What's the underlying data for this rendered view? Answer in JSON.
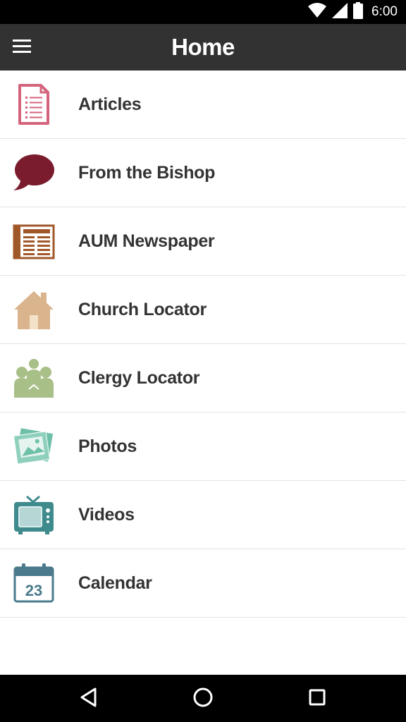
{
  "status_bar": {
    "time": "6:00",
    "icons": [
      "wifi-icon",
      "signal-icon",
      "battery-icon"
    ]
  },
  "app_bar": {
    "title": "Home",
    "menu_icon": "hamburger-menu-icon"
  },
  "menu": {
    "items": [
      {
        "label": "Articles",
        "icon": "document-icon",
        "color": "#d4647c"
      },
      {
        "label": "From the Bishop",
        "icon": "speech-bubble-icon",
        "color": "#7a1c2e"
      },
      {
        "label": "AUM Newspaper",
        "icon": "newspaper-icon",
        "color": "#a0582a"
      },
      {
        "label": "Church Locator",
        "icon": "house-icon",
        "color": "#d9b48c"
      },
      {
        "label": "Clergy Locator",
        "icon": "people-icon",
        "color": "#a9bf88"
      },
      {
        "label": "Photos",
        "icon": "photos-icon",
        "color": "#6dbfa8"
      },
      {
        "label": "Videos",
        "icon": "tv-icon",
        "color": "#3f8a8c"
      },
      {
        "label": "Calendar",
        "icon": "calendar-icon",
        "color": "#4a7a8c",
        "day": "23"
      }
    ]
  },
  "nav_bar": {
    "icons": [
      "back-icon",
      "home-icon",
      "recents-icon"
    ]
  }
}
